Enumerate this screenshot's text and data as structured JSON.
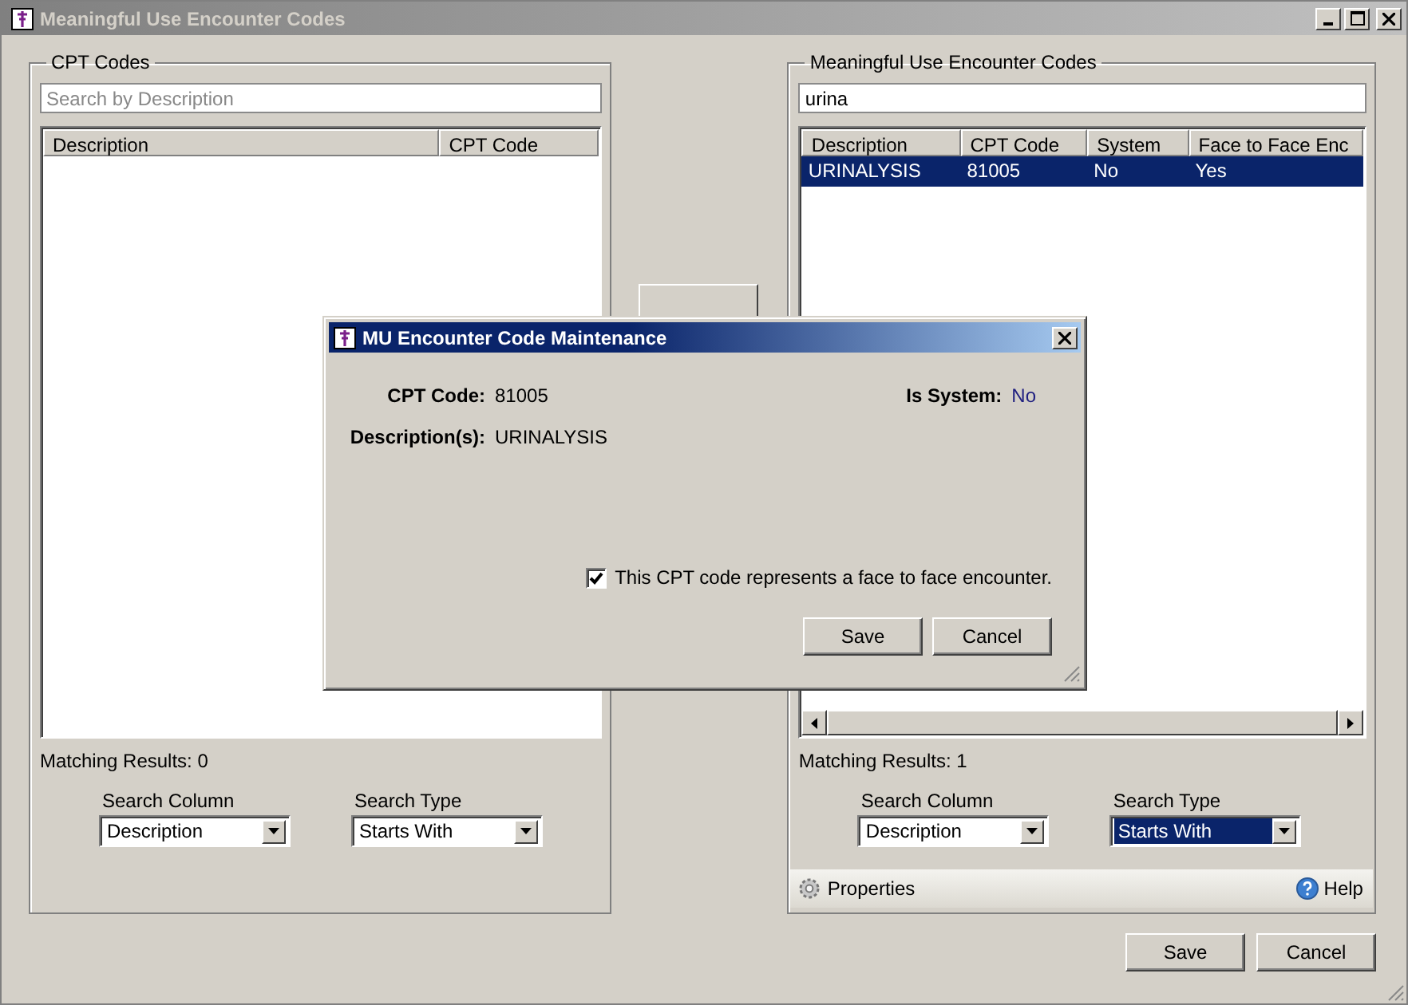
{
  "window": {
    "title": "Meaningful Use Encounter Codes"
  },
  "left_panel": {
    "title": "CPT Codes",
    "search": {
      "placeholder": "Search by Description"
    },
    "columns": [
      "Description",
      "CPT Code"
    ],
    "matching_results": "Matching Results: 0",
    "search_column": {
      "label": "Search Column",
      "value": "Description",
      "focused": false
    },
    "search_type": {
      "label": "Search Type",
      "value": "Starts With",
      "focused": false
    }
  },
  "right_panel": {
    "title": "Meaningful Use Encounter Codes",
    "search": {
      "value": "urina"
    },
    "columns": [
      "Description",
      "CPT Code",
      "System",
      "Face to Face Enc"
    ],
    "rows": [
      {
        "cells": [
          "URINALYSIS",
          "81005",
          "No",
          "Yes"
        ],
        "selected": true
      }
    ],
    "matching_results": "Matching Results: 1",
    "search_column": {
      "label": "Search Column",
      "value": "Description",
      "focused": false
    },
    "search_type": {
      "label": "Search Type",
      "value": "Starts With",
      "focused": true
    },
    "properties": "Properties",
    "help": "Help"
  },
  "dialog": {
    "title": "MU Encounter Code Maintenance",
    "cpt_label": "CPT Code:",
    "cpt_value": "81005",
    "system_label": "Is System:",
    "system_value": "No",
    "description_label": "Description(s):",
    "description_value": "URINALYSIS",
    "checkbox": {
      "label": "This CPT code represents a face to face encounter.",
      "checked": true
    },
    "buttons": [
      "Save",
      "Cancel"
    ]
  },
  "buttons": [
    "Save",
    "Cancel"
  ]
}
